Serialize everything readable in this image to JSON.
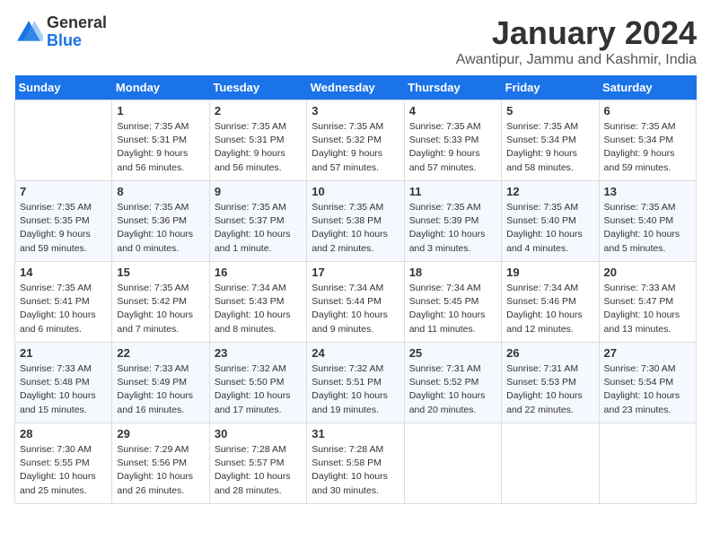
{
  "header": {
    "logo_general": "General",
    "logo_blue": "Blue",
    "title": "January 2024",
    "subtitle": "Awantipur, Jammu and Kashmir, India"
  },
  "weekdays": [
    "Sunday",
    "Monday",
    "Tuesday",
    "Wednesday",
    "Thursday",
    "Friday",
    "Saturday"
  ],
  "weeks": [
    [
      {
        "day": "",
        "empty": true
      },
      {
        "day": "1",
        "sunrise": "Sunrise: 7:35 AM",
        "sunset": "Sunset: 5:31 PM",
        "daylight": "Daylight: 9 hours and 56 minutes."
      },
      {
        "day": "2",
        "sunrise": "Sunrise: 7:35 AM",
        "sunset": "Sunset: 5:31 PM",
        "daylight": "Daylight: 9 hours and 56 minutes."
      },
      {
        "day": "3",
        "sunrise": "Sunrise: 7:35 AM",
        "sunset": "Sunset: 5:32 PM",
        "daylight": "Daylight: 9 hours and 57 minutes."
      },
      {
        "day": "4",
        "sunrise": "Sunrise: 7:35 AM",
        "sunset": "Sunset: 5:33 PM",
        "daylight": "Daylight: 9 hours and 57 minutes."
      },
      {
        "day": "5",
        "sunrise": "Sunrise: 7:35 AM",
        "sunset": "Sunset: 5:34 PM",
        "daylight": "Daylight: 9 hours and 58 minutes."
      },
      {
        "day": "6",
        "sunrise": "Sunrise: 7:35 AM",
        "sunset": "Sunset: 5:34 PM",
        "daylight": "Daylight: 9 hours and 59 minutes."
      }
    ],
    [
      {
        "day": "7",
        "sunrise": "Sunrise: 7:35 AM",
        "sunset": "Sunset: 5:35 PM",
        "daylight": "Daylight: 9 hours and 59 minutes."
      },
      {
        "day": "8",
        "sunrise": "Sunrise: 7:35 AM",
        "sunset": "Sunset: 5:36 PM",
        "daylight": "Daylight: 10 hours and 0 minutes."
      },
      {
        "day": "9",
        "sunrise": "Sunrise: 7:35 AM",
        "sunset": "Sunset: 5:37 PM",
        "daylight": "Daylight: 10 hours and 1 minute."
      },
      {
        "day": "10",
        "sunrise": "Sunrise: 7:35 AM",
        "sunset": "Sunset: 5:38 PM",
        "daylight": "Daylight: 10 hours and 2 minutes."
      },
      {
        "day": "11",
        "sunrise": "Sunrise: 7:35 AM",
        "sunset": "Sunset: 5:39 PM",
        "daylight": "Daylight: 10 hours and 3 minutes."
      },
      {
        "day": "12",
        "sunrise": "Sunrise: 7:35 AM",
        "sunset": "Sunset: 5:40 PM",
        "daylight": "Daylight: 10 hours and 4 minutes."
      },
      {
        "day": "13",
        "sunrise": "Sunrise: 7:35 AM",
        "sunset": "Sunset: 5:40 PM",
        "daylight": "Daylight: 10 hours and 5 minutes."
      }
    ],
    [
      {
        "day": "14",
        "sunrise": "Sunrise: 7:35 AM",
        "sunset": "Sunset: 5:41 PM",
        "daylight": "Daylight: 10 hours and 6 minutes."
      },
      {
        "day": "15",
        "sunrise": "Sunrise: 7:35 AM",
        "sunset": "Sunset: 5:42 PM",
        "daylight": "Daylight: 10 hours and 7 minutes."
      },
      {
        "day": "16",
        "sunrise": "Sunrise: 7:34 AM",
        "sunset": "Sunset: 5:43 PM",
        "daylight": "Daylight: 10 hours and 8 minutes."
      },
      {
        "day": "17",
        "sunrise": "Sunrise: 7:34 AM",
        "sunset": "Sunset: 5:44 PM",
        "daylight": "Daylight: 10 hours and 9 minutes."
      },
      {
        "day": "18",
        "sunrise": "Sunrise: 7:34 AM",
        "sunset": "Sunset: 5:45 PM",
        "daylight": "Daylight: 10 hours and 11 minutes."
      },
      {
        "day": "19",
        "sunrise": "Sunrise: 7:34 AM",
        "sunset": "Sunset: 5:46 PM",
        "daylight": "Daylight: 10 hours and 12 minutes."
      },
      {
        "day": "20",
        "sunrise": "Sunrise: 7:33 AM",
        "sunset": "Sunset: 5:47 PM",
        "daylight": "Daylight: 10 hours and 13 minutes."
      }
    ],
    [
      {
        "day": "21",
        "sunrise": "Sunrise: 7:33 AM",
        "sunset": "Sunset: 5:48 PM",
        "daylight": "Daylight: 10 hours and 15 minutes."
      },
      {
        "day": "22",
        "sunrise": "Sunrise: 7:33 AM",
        "sunset": "Sunset: 5:49 PM",
        "daylight": "Daylight: 10 hours and 16 minutes."
      },
      {
        "day": "23",
        "sunrise": "Sunrise: 7:32 AM",
        "sunset": "Sunset: 5:50 PM",
        "daylight": "Daylight: 10 hours and 17 minutes."
      },
      {
        "day": "24",
        "sunrise": "Sunrise: 7:32 AM",
        "sunset": "Sunset: 5:51 PM",
        "daylight": "Daylight: 10 hours and 19 minutes."
      },
      {
        "day": "25",
        "sunrise": "Sunrise: 7:31 AM",
        "sunset": "Sunset: 5:52 PM",
        "daylight": "Daylight: 10 hours and 20 minutes."
      },
      {
        "day": "26",
        "sunrise": "Sunrise: 7:31 AM",
        "sunset": "Sunset: 5:53 PM",
        "daylight": "Daylight: 10 hours and 22 minutes."
      },
      {
        "day": "27",
        "sunrise": "Sunrise: 7:30 AM",
        "sunset": "Sunset: 5:54 PM",
        "daylight": "Daylight: 10 hours and 23 minutes."
      }
    ],
    [
      {
        "day": "28",
        "sunrise": "Sunrise: 7:30 AM",
        "sunset": "Sunset: 5:55 PM",
        "daylight": "Daylight: 10 hours and 25 minutes."
      },
      {
        "day": "29",
        "sunrise": "Sunrise: 7:29 AM",
        "sunset": "Sunset: 5:56 PM",
        "daylight": "Daylight: 10 hours and 26 minutes."
      },
      {
        "day": "30",
        "sunrise": "Sunrise: 7:28 AM",
        "sunset": "Sunset: 5:57 PM",
        "daylight": "Daylight: 10 hours and 28 minutes."
      },
      {
        "day": "31",
        "sunrise": "Sunrise: 7:28 AM",
        "sunset": "Sunset: 5:58 PM",
        "daylight": "Daylight: 10 hours and 30 minutes."
      },
      {
        "day": "",
        "empty": true
      },
      {
        "day": "",
        "empty": true
      },
      {
        "day": "",
        "empty": true
      }
    ]
  ]
}
